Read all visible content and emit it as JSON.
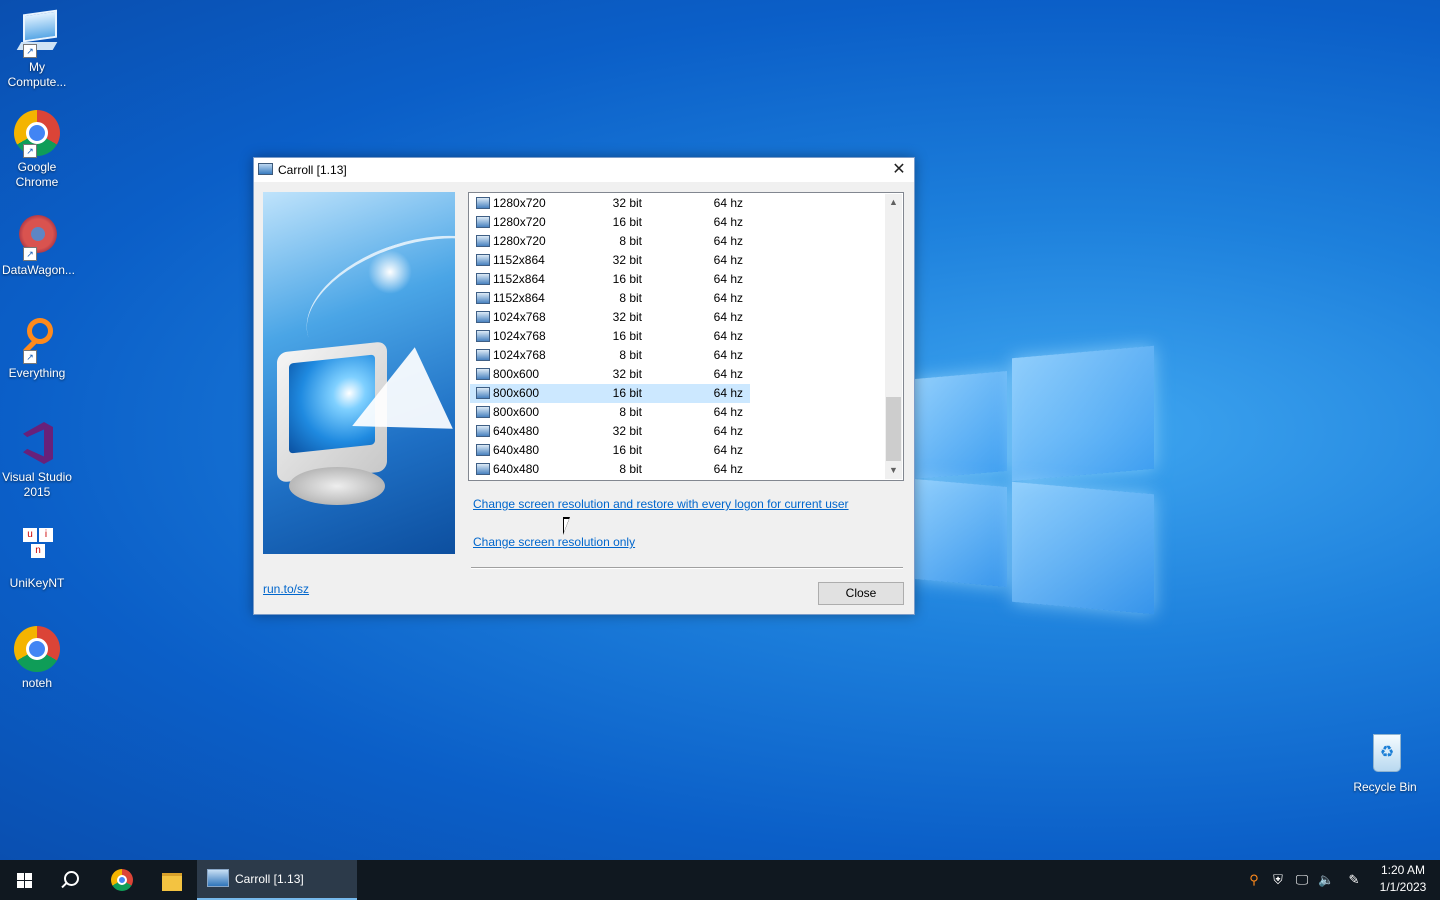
{
  "desktop": {
    "icons": [
      {
        "label_line1": "My",
        "label_line2": "Compute..."
      },
      {
        "label_line1": "Google",
        "label_line2": "Chrome"
      },
      {
        "label_line1": "DataWagon...",
        "label_line2": ""
      },
      {
        "label_line1": "Everything",
        "label_line2": ""
      },
      {
        "label_line1": "Visual Studio",
        "label_line2": "2015"
      },
      {
        "label_line1": "UniKeyNT",
        "label_line2": ""
      },
      {
        "label_line1": "noteh",
        "label_line2": ""
      }
    ],
    "recycle_bin": "Recycle Bin"
  },
  "dialog": {
    "title": "Carroll [1.13]",
    "close_glyph": "✕",
    "resolutions": [
      {
        "res": "1280x720",
        "bits": "32 bit",
        "hz": "64 hz"
      },
      {
        "res": "1280x720",
        "bits": "16 bit",
        "hz": "64 hz"
      },
      {
        "res": "1280x720",
        "bits": "8 bit",
        "hz": "64 hz"
      },
      {
        "res": "1152x864",
        "bits": "32 bit",
        "hz": "64 hz"
      },
      {
        "res": "1152x864",
        "bits": "16 bit",
        "hz": "64 hz"
      },
      {
        "res": "1152x864",
        "bits": "8 bit",
        "hz": "64 hz"
      },
      {
        "res": "1024x768",
        "bits": "32 bit",
        "hz": "64 hz"
      },
      {
        "res": "1024x768",
        "bits": "16 bit",
        "hz": "64 hz"
      },
      {
        "res": "1024x768",
        "bits": "8 bit",
        "hz": "64 hz"
      },
      {
        "res": "800x600",
        "bits": "32 bit",
        "hz": "64 hz"
      },
      {
        "res": "800x600",
        "bits": "16 bit",
        "hz": "64 hz",
        "selected": true
      },
      {
        "res": "800x600",
        "bits": "8 bit",
        "hz": "64 hz"
      },
      {
        "res": "640x480",
        "bits": "32 bit",
        "hz": "64 hz"
      },
      {
        "res": "640x480",
        "bits": "16 bit",
        "hz": "64 hz"
      },
      {
        "res": "640x480",
        "bits": "8 bit",
        "hz": "64 hz"
      }
    ],
    "link_restore": "Change screen resolution and restore with every logon for current user",
    "link_only": "Change screen resolution only",
    "link_site": "run.to/sz",
    "close_button": "Close"
  },
  "taskbar": {
    "app_label": "Carroll [1.13]",
    "clock_time": "1:20 AM",
    "clock_date": "1/1/2023"
  },
  "colors": {
    "link": "#0066cc",
    "selection": "#cce8ff",
    "taskbar": "#101820",
    "desktop": "#1d80dc"
  }
}
